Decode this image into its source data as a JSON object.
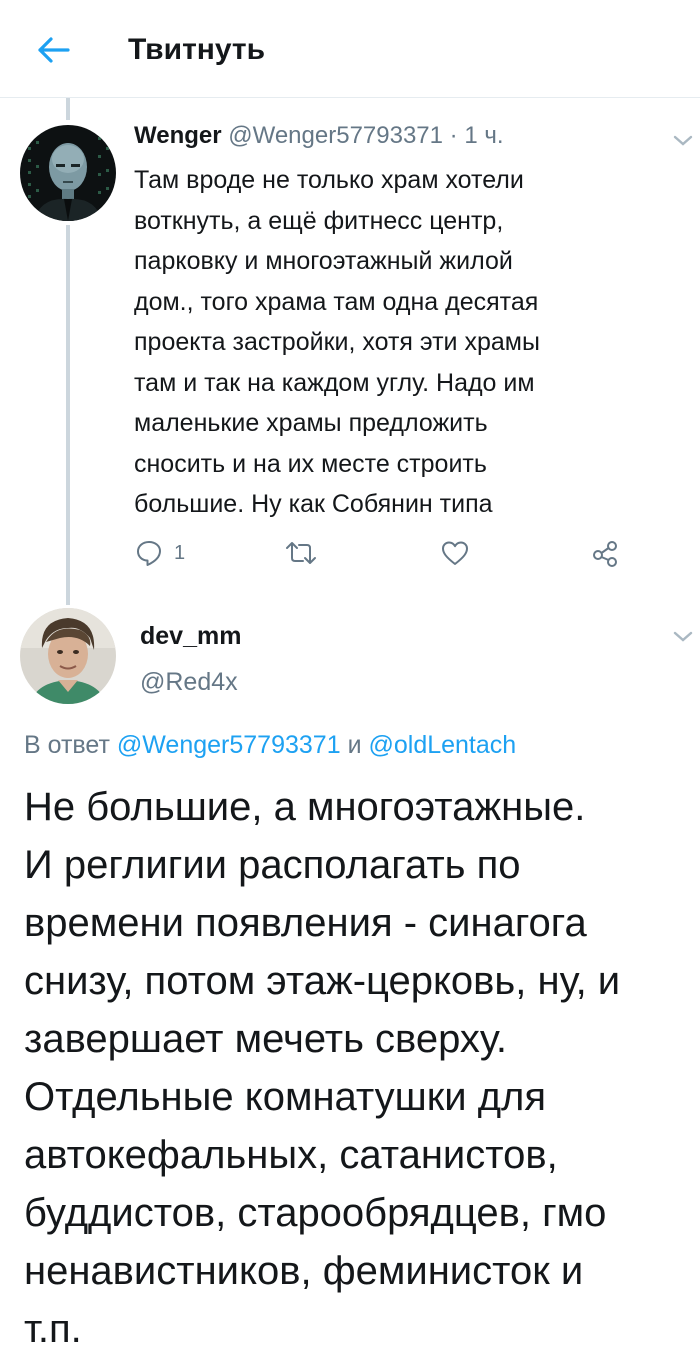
{
  "header": {
    "title": "Твитнуть",
    "back_icon": "arrow-left-icon"
  },
  "colors": {
    "accent": "#1da1f2",
    "secondary_text": "#657786",
    "thread_line": "#ccd6dd"
  },
  "tweet1": {
    "name": "Wenger",
    "handle": "@Wenger57793371",
    "separator": "·",
    "time": "1 ч.",
    "lines": [
      "Там вроде не только храм хотели",
      "воткнуть, а ещё фитнесс центр,",
      "парковку и многоэтажный жилой",
      "дом., того храма там одна десятая",
      "проекта застройки, хотя эти храмы",
      "там и так на каждом углу. Надо им",
      "маленькие храмы предложить",
      "сносить и на их месте строить",
      "большие. Ну как Собянин типа"
    ],
    "reply_count": "1"
  },
  "tweet2": {
    "name": "dev_mm",
    "handle": "@Red4x",
    "reply_prefix": "В ответ",
    "reply_user1": "@Wenger57793371",
    "reply_and": "и",
    "reply_user2": "@oldLentach",
    "lines": [
      "Не большие, а многоэтажные.",
      "И реглигии располагать по",
      "времени появления - синагога",
      "снизу, потом этаж-церковь, ну, и",
      "завершает мечеть сверху.",
      "Отдельные комнатушки для",
      "автокефальных, сатанистов,",
      "буддистов, старообрядцев, гмо",
      "ненавистников, феминисток и",
      "т.п."
    ]
  }
}
